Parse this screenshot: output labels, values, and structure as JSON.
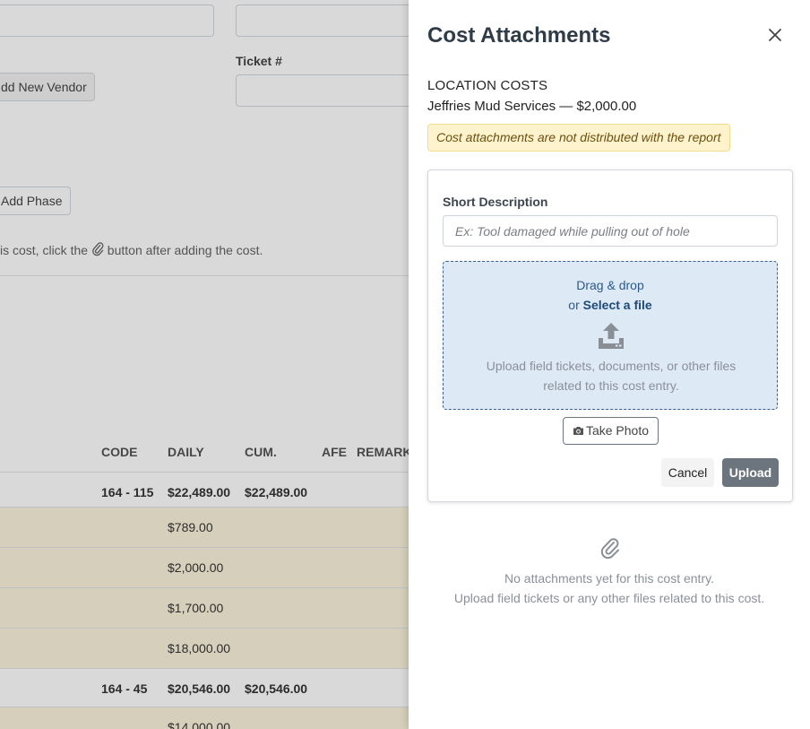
{
  "background": {
    "ticket_label": "Ticket #",
    "add_vendor_label": "dd New Vendor",
    "add_phase_label": "Add Phase",
    "hint_before": "is cost, click the ",
    "hint_after": " button after adding the cost.",
    "table": {
      "headers": [
        "CODE",
        "DAILY",
        "CUM.",
        "AFE",
        "REMARK"
      ],
      "rows": [
        {
          "code": "164 - 115",
          "daily": "$22,489.00",
          "cum": "$22,489.00",
          "bold": true
        },
        {
          "code": "",
          "daily": "$789.00",
          "cum": "",
          "bold": false
        },
        {
          "code": "",
          "daily": "$2,000.00",
          "cum": "",
          "bold": false
        },
        {
          "code": "",
          "daily": "$1,700.00",
          "cum": "",
          "bold": false
        },
        {
          "code": "",
          "daily": "$18,000.00",
          "cum": "",
          "bold": false
        },
        {
          "code": "164 - 45",
          "daily": "$20,546.00",
          "cum": "$20,546.00",
          "bold": true
        },
        {
          "code": "",
          "daily": "$14,000.00",
          "cum": "",
          "bold": false
        }
      ]
    }
  },
  "drawer": {
    "title": "Cost Attachments",
    "section_label": "LOCATION COSTS",
    "vendor_line": "Jeffries Mud Services — $2,000.00",
    "warning": "Cost attachments are not distributed with the report",
    "form": {
      "short_desc_label": "Short Description",
      "short_desc_placeholder": "Ex: Tool damaged while pulling out of hole",
      "short_desc_value": "",
      "dropzone": {
        "line1": "Drag & drop",
        "line2_prefix": "or ",
        "line2_link": "Select a file",
        "help_text": "Upload field tickets, documents, or other files related to this cost entry."
      },
      "take_photo_label": "Take Photo",
      "cancel_label": "Cancel",
      "upload_label": "Upload"
    },
    "empty_state": {
      "line1": "No attachments yet for this cost entry.",
      "line2": "Upload field tickets or any other files related to this cost."
    },
    "icons": {
      "close": "close-icon",
      "upload": "upload-icon",
      "camera": "camera-icon",
      "paperclip": "paperclip-icon"
    },
    "colors": {
      "warning_bg": "#fff3cd",
      "dropzone_bg": "#dde9f5",
      "upload_btn": "#6c757d",
      "row_tint": "#fbf3d9"
    }
  }
}
